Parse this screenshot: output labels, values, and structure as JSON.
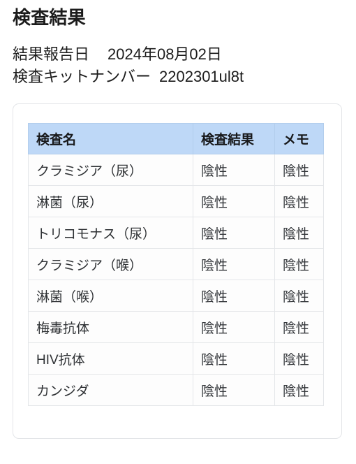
{
  "page": {
    "title": "検査結果"
  },
  "meta": {
    "report_date": {
      "label": "結果報告日",
      "value": "2024年08月02日"
    },
    "kit_number": {
      "label": "検査キットナンバー",
      "value": "2202301ul8t"
    }
  },
  "colors": {
    "header_background": "#bed8f7",
    "card_border": "#e3e5e8",
    "cell_border": "#e4e6e9",
    "text": "#1c1c1c"
  },
  "table": {
    "columns": [
      {
        "key": "name",
        "label": "検査名"
      },
      {
        "key": "result",
        "label": "検査結果"
      },
      {
        "key": "memo",
        "label": "メモ"
      }
    ],
    "rows": [
      {
        "name": "クラミジア（尿）",
        "result": "陰性",
        "memo": "陰性"
      },
      {
        "name": "淋菌（尿）",
        "result": "陰性",
        "memo": "陰性"
      },
      {
        "name": "トリコモナス（尿）",
        "result": "陰性",
        "memo": "陰性"
      },
      {
        "name": "クラミジア（喉）",
        "result": "陰性",
        "memo": "陰性"
      },
      {
        "name": "淋菌（喉）",
        "result": "陰性",
        "memo": "陰性"
      },
      {
        "name": "梅毒抗体",
        "result": "陰性",
        "memo": "陰性"
      },
      {
        "name": "HIV抗体",
        "result": "陰性",
        "memo": "陰性"
      },
      {
        "name": "カンジダ",
        "result": "陰性",
        "memo": "陰性"
      }
    ]
  }
}
